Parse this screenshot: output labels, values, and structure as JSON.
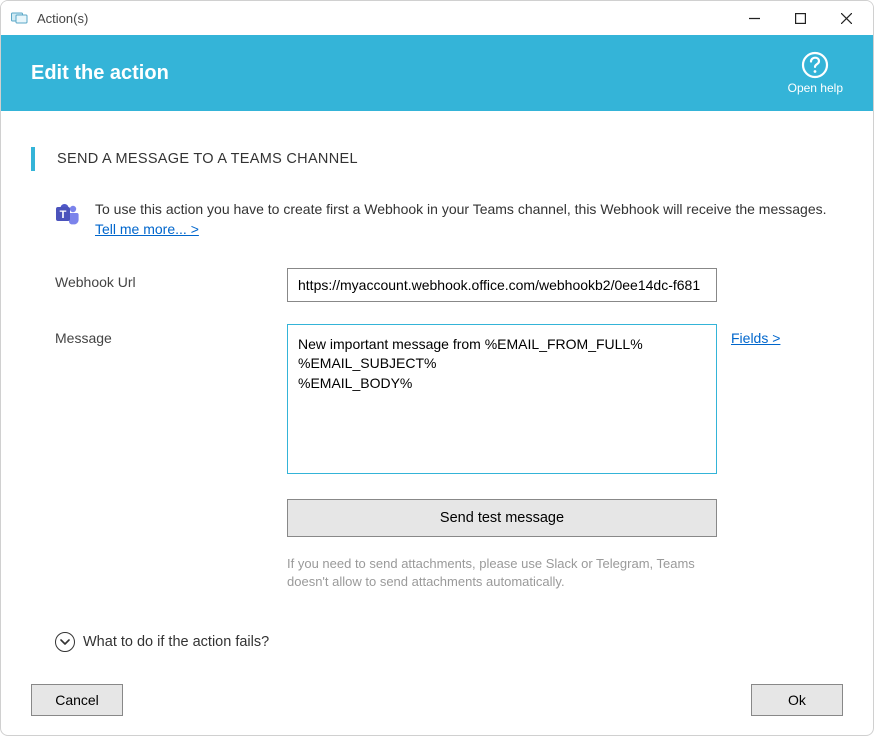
{
  "window": {
    "title": "Action(s)"
  },
  "banner": {
    "title": "Edit the action",
    "help_label": "Open help"
  },
  "section": {
    "title": "SEND A MESSAGE TO A TEAMS CHANNEL"
  },
  "info": {
    "text_prefix": "To use this action you have to create first a Webhook in your Teams channel, this Webhook will receive the messages. ",
    "tell_me_more": "Tell me more... >"
  },
  "form": {
    "webhook_label": "Webhook Url",
    "webhook_value": "https://myaccount.webhook.office.com/webhookb2/0ee14dc-f681",
    "message_label": "Message",
    "message_value": "New important message from %EMAIL_FROM_FULL%\n%EMAIL_SUBJECT%\n%EMAIL_BODY%",
    "fields_link": "Fields >",
    "test_button": "Send test message",
    "attachment_hint": "If you need to send attachments, please use Slack or Telegram, Teams doesn't allow to send attachments automatically."
  },
  "expander": {
    "label": "What to do if the action fails?"
  },
  "footer": {
    "cancel": "Cancel",
    "ok": "Ok"
  }
}
